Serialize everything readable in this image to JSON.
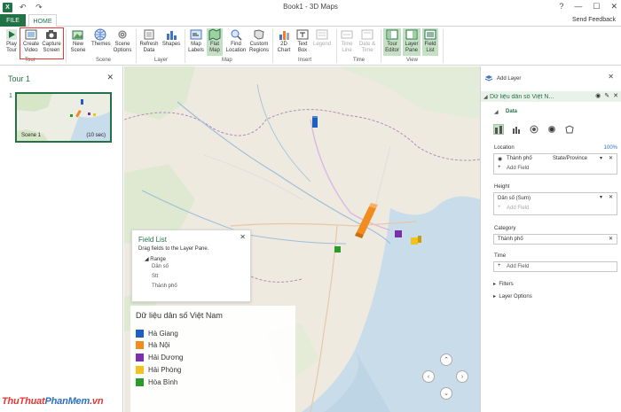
{
  "window": {
    "title": "Book1 - 3D Maps",
    "app_icon": "X",
    "send_feedback": "Send Feedback"
  },
  "tabs": {
    "file": "FILE",
    "home": "HOME"
  },
  "ribbon": {
    "play_tour": "Play Tour",
    "create_video": "Create Video",
    "capture_screen": "Capture Screen",
    "new_scene": "New Scene",
    "themes": "Themes",
    "scene_options": "Scene Options",
    "refresh_data": "Refresh Data",
    "shapes": "Shapes",
    "map_labels": "Map Labels",
    "flat_map": "Flat Map",
    "find_location": "Find Location",
    "custom_regions": "Custom Regions",
    "chart_2d": "2D Chart",
    "text_box": "Text Box",
    "legend": "Legend",
    "time_line": "Time Line",
    "date_time": "Date & Time",
    "tour_editor": "Tour Editor",
    "layer_pane": "Layer Pane",
    "field_list": "Field List",
    "groups": {
      "tour": "Tour",
      "scene": "Scene",
      "layer": "Layer",
      "map": "Map",
      "insert": "Insert",
      "time": "Time",
      "view": "View"
    }
  },
  "tour": {
    "title": "Tour 1",
    "scene_number": "1",
    "scene_label": "Scene 1",
    "scene_duration": "(10 sec)"
  },
  "field_list": {
    "title": "Field List",
    "description": "Drag fields to the Layer Pane.",
    "range_label": "Range",
    "fields": [
      "Dân số",
      "Stt",
      "Thành phố"
    ]
  },
  "legend": {
    "title": "Dữ liệu dân số Việt Nam",
    "items": [
      {
        "label": "Hà Giang",
        "color": "#1f5fbf"
      },
      {
        "label": "Hà Nội",
        "color": "#f28c1e"
      },
      {
        "label": "Hải Dương",
        "color": "#7b2fa8"
      },
      {
        "label": "Hải Phòng",
        "color": "#f2c21e"
      },
      {
        "label": "Hòa Bình",
        "color": "#2a9a2a"
      }
    ]
  },
  "layer_pane": {
    "add_layer": "Add Layer",
    "layer_name": "Dữ liệu dân số Việt N...",
    "data_section": "Data",
    "location_label": "Location",
    "location_percent": "100%",
    "location_field": "Thành phố",
    "location_type": "State/Province",
    "add_field": "Add Field",
    "height_label": "Height",
    "height_field": "Dân số (Sum)",
    "category_label": "Category",
    "category_field": "Thành phố",
    "time_label": "Time",
    "filters": "Filters",
    "layer_options": "Layer Options"
  },
  "watermark": {
    "part1": "ThuThuat",
    "part2": "PhanMem",
    "part3": ".vn"
  }
}
